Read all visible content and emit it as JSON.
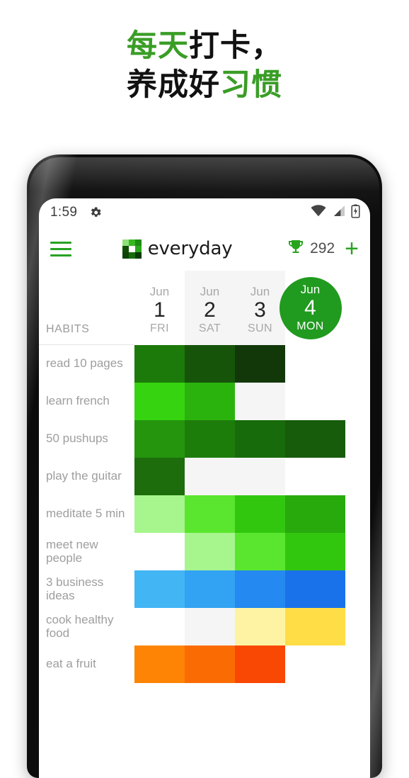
{
  "headline": {
    "line1_green": "每天",
    "line1_black": "打卡，",
    "line2_black": "养成好",
    "line2_green": "习惯"
  },
  "colors": {
    "brand_green": "#27a223",
    "today_circle": "#219a20",
    "headline_green": "#3a9d26",
    "headline_black": "#111111",
    "label_gray": "#9e9e9e",
    "shaded_column": "#f5f5f5"
  },
  "status_bar": {
    "time": "1:59",
    "gear_icon": "gear-icon",
    "wifi_icon": "wifi-icon",
    "signal_icon": "signal-icon",
    "battery_icon": "battery-charging-icon"
  },
  "app_bar": {
    "menu_icon": "hamburger-menu-icon",
    "logo_icon": "everyday-logo-icon",
    "brand_name": "everyday",
    "trophy_icon": "trophy-icon",
    "trophy_count": "292",
    "add_label": "+"
  },
  "table": {
    "habits_header": "HABITS",
    "dates": [
      {
        "month": "Jun",
        "day": "1",
        "dow": "FRI",
        "shaded": false,
        "today": false
      },
      {
        "month": "Jun",
        "day": "2",
        "dow": "SAT",
        "shaded": true,
        "today": false
      },
      {
        "month": "Jun",
        "day": "3",
        "dow": "SUN",
        "shaded": true,
        "today": false
      },
      {
        "month": "Jun",
        "day": "4",
        "dow": "MON",
        "shaded": false,
        "today": true
      }
    ],
    "rows": [
      {
        "name": "read 10 pages",
        "cells": [
          "#1c7a0a",
          "#16540a",
          "#12380a",
          "#ffffff"
        ]
      },
      {
        "name": "learn french",
        "cells": [
          "#36d410",
          "#2bb30d",
          "#f5f5f5",
          "#ffffff"
        ]
      },
      {
        "name": "50 pushups",
        "cells": [
          "#24950d",
          "#1d7d0b",
          "#176b0a",
          "#165c0a"
        ]
      },
      {
        "name": "play the guitar",
        "cells": [
          "#1d6d0c",
          "#f5f5f5",
          "#f5f5f5",
          "#ffffff"
        ]
      },
      {
        "name": "meditate 5 min",
        "cells": [
          "#a6f58d",
          "#5ae62e",
          "#31c70f",
          "#28aa0d"
        ]
      },
      {
        "name": "meet new people",
        "cells": [
          "#ffffff",
          "#a6f58d",
          "#5ae62e",
          "#31c70f"
        ]
      },
      {
        "name": "3 business ideas",
        "cells": [
          "#42b5f5",
          "#31a3f2",
          "#2489f0",
          "#1a72ea"
        ]
      },
      {
        "name": "cook healthy food",
        "cells": [
          "#ffffff",
          "#f5f5f5",
          "#fdf3a2",
          "#ffdd47"
        ]
      },
      {
        "name": "eat a fruit",
        "cells": [
          "#fd8404",
          "#fb6b03",
          "#f94704",
          "#ffffff"
        ]
      }
    ]
  }
}
